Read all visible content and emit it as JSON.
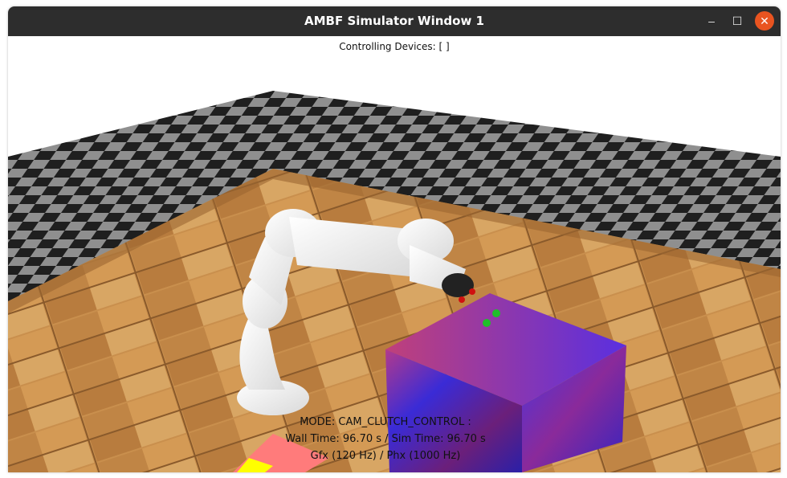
{
  "window": {
    "title": "AMBF Simulator Window 1",
    "controls": {
      "minimize": "–",
      "maximize": "☐",
      "close": "✕"
    },
    "accent_close": "#e95420"
  },
  "overlay": {
    "controlling_devices": "Controlling Devices: [  ]",
    "mode": "MODE: CAM_CLUTCH_CONTROL :",
    "time": "Wall Time: 96.70 s / Sim Time: 96.70 s",
    "rates": "Gfx (120 Hz) / Phx (1000 Hz)"
  },
  "scene": {
    "floor_light": "#8f8f8f",
    "floor_dark": "#1f1f1f",
    "wood": "#c98f4d",
    "robot": "#f5f5f5",
    "cube_primary": "#3a2bd6",
    "cube_secondary": "#b23a8c"
  }
}
